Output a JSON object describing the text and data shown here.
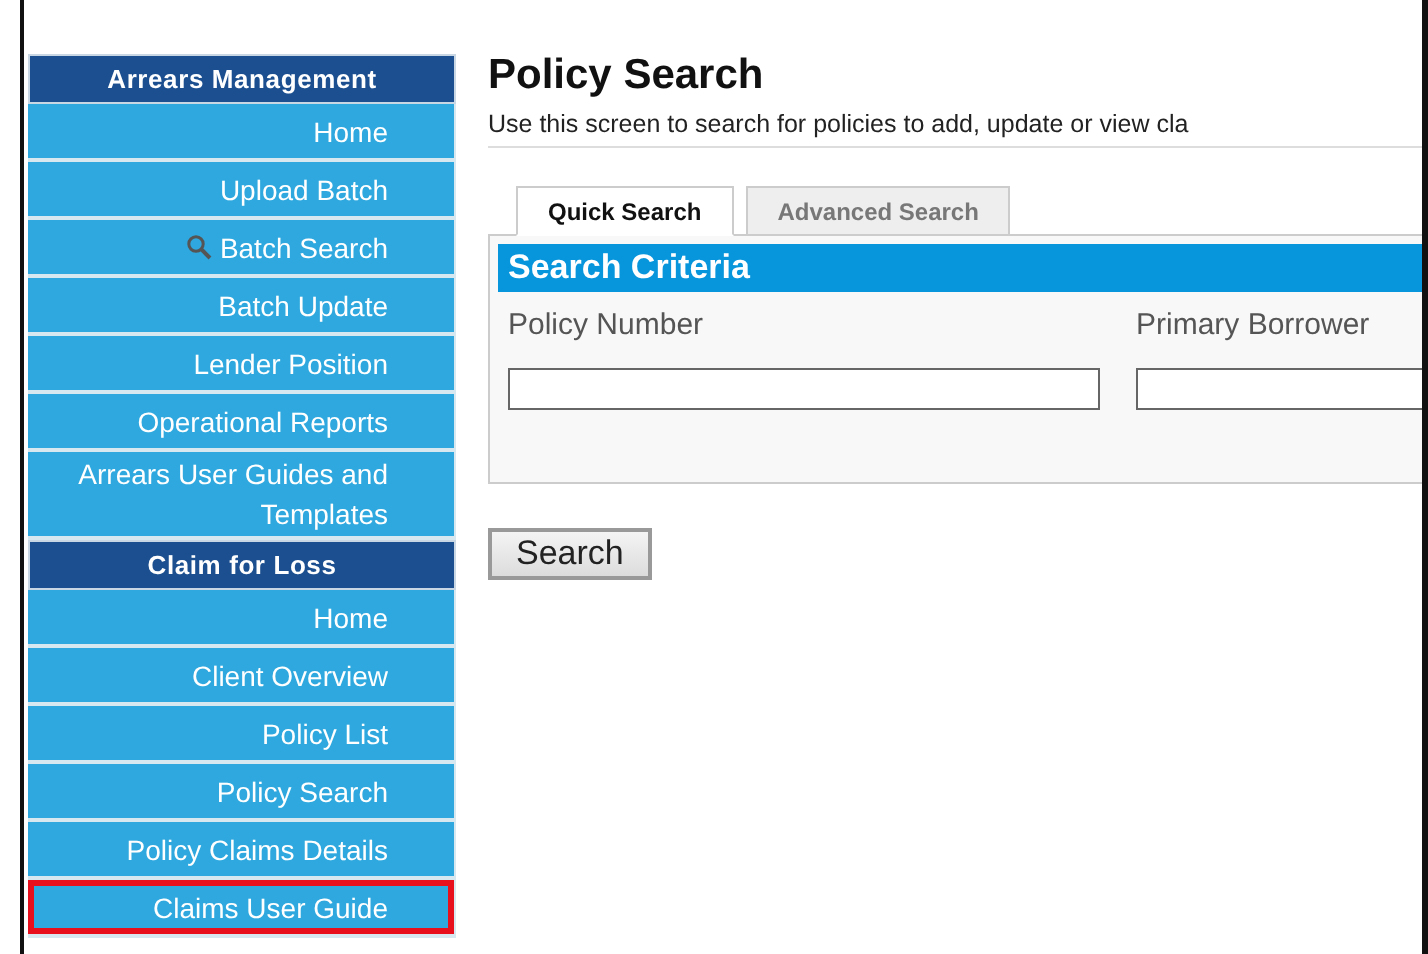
{
  "sidebar": {
    "sections": [
      {
        "title": "Arrears Management",
        "items": [
          {
            "label": "Home",
            "icon": false,
            "highlighted": false
          },
          {
            "label": "Upload Batch",
            "icon": false,
            "highlighted": false
          },
          {
            "label": "Batch Search",
            "icon": true,
            "highlighted": false
          },
          {
            "label": "Batch Update",
            "icon": false,
            "highlighted": false
          },
          {
            "label": "Lender Position",
            "icon": false,
            "highlighted": false
          },
          {
            "label": "Operational Reports",
            "icon": false,
            "highlighted": false
          },
          {
            "label": "Arrears User Guides and Templates",
            "icon": false,
            "highlighted": false
          }
        ]
      },
      {
        "title": "Claim for Loss",
        "items": [
          {
            "label": "Home",
            "icon": false,
            "highlighted": false
          },
          {
            "label": "Client Overview",
            "icon": false,
            "highlighted": false
          },
          {
            "label": "Policy List",
            "icon": false,
            "highlighted": false
          },
          {
            "label": "Policy Search",
            "icon": false,
            "highlighted": false
          },
          {
            "label": "Policy Claims Details",
            "icon": false,
            "highlighted": false
          },
          {
            "label": "Claims User Guide",
            "icon": false,
            "highlighted": true
          }
        ]
      }
    ]
  },
  "page": {
    "title": "Policy Search",
    "description": "Use this screen to search for policies to add, update or view cla"
  },
  "tabs": [
    {
      "label": "Quick Search",
      "selected": true
    },
    {
      "label": "Advanced Search",
      "selected": false
    }
  ],
  "criteria": {
    "title": "Search Criteria",
    "fields": [
      {
        "label": "Policy Number"
      },
      {
        "label": "Primary Borrower"
      }
    ]
  },
  "search_button": "Search"
}
